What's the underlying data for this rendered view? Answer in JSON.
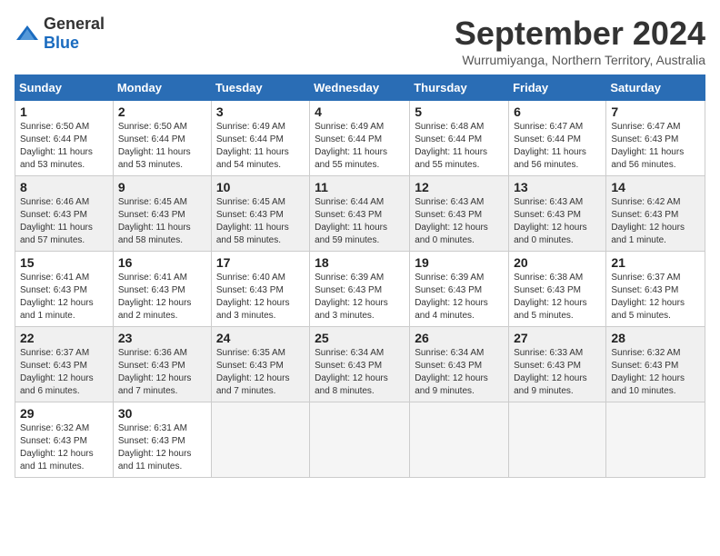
{
  "logo": {
    "general": "General",
    "blue": "Blue"
  },
  "title": "September 2024",
  "subtitle": "Wurrumiyanga, Northern Territory, Australia",
  "headers": [
    "Sunday",
    "Monday",
    "Tuesday",
    "Wednesday",
    "Thursday",
    "Friday",
    "Saturday"
  ],
  "weeks": [
    [
      {
        "day": "1",
        "sunrise": "Sunrise: 6:50 AM",
        "sunset": "Sunset: 6:44 PM",
        "daylight": "Daylight: 11 hours and 53 minutes."
      },
      {
        "day": "2",
        "sunrise": "Sunrise: 6:50 AM",
        "sunset": "Sunset: 6:44 PM",
        "daylight": "Daylight: 11 hours and 53 minutes."
      },
      {
        "day": "3",
        "sunrise": "Sunrise: 6:49 AM",
        "sunset": "Sunset: 6:44 PM",
        "daylight": "Daylight: 11 hours and 54 minutes."
      },
      {
        "day": "4",
        "sunrise": "Sunrise: 6:49 AM",
        "sunset": "Sunset: 6:44 PM",
        "daylight": "Daylight: 11 hours and 55 minutes."
      },
      {
        "day": "5",
        "sunrise": "Sunrise: 6:48 AM",
        "sunset": "Sunset: 6:44 PM",
        "daylight": "Daylight: 11 hours and 55 minutes."
      },
      {
        "day": "6",
        "sunrise": "Sunrise: 6:47 AM",
        "sunset": "Sunset: 6:44 PM",
        "daylight": "Daylight: 11 hours and 56 minutes."
      },
      {
        "day": "7",
        "sunrise": "Sunrise: 6:47 AM",
        "sunset": "Sunset: 6:43 PM",
        "daylight": "Daylight: 11 hours and 56 minutes."
      }
    ],
    [
      {
        "day": "8",
        "sunrise": "Sunrise: 6:46 AM",
        "sunset": "Sunset: 6:43 PM",
        "daylight": "Daylight: 11 hours and 57 minutes."
      },
      {
        "day": "9",
        "sunrise": "Sunrise: 6:45 AM",
        "sunset": "Sunset: 6:43 PM",
        "daylight": "Daylight: 11 hours and 58 minutes."
      },
      {
        "day": "10",
        "sunrise": "Sunrise: 6:45 AM",
        "sunset": "Sunset: 6:43 PM",
        "daylight": "Daylight: 11 hours and 58 minutes."
      },
      {
        "day": "11",
        "sunrise": "Sunrise: 6:44 AM",
        "sunset": "Sunset: 6:43 PM",
        "daylight": "Daylight: 11 hours and 59 minutes."
      },
      {
        "day": "12",
        "sunrise": "Sunrise: 6:43 AM",
        "sunset": "Sunset: 6:43 PM",
        "daylight": "Daylight: 12 hours and 0 minutes."
      },
      {
        "day": "13",
        "sunrise": "Sunrise: 6:43 AM",
        "sunset": "Sunset: 6:43 PM",
        "daylight": "Daylight: 12 hours and 0 minutes."
      },
      {
        "day": "14",
        "sunrise": "Sunrise: 6:42 AM",
        "sunset": "Sunset: 6:43 PM",
        "daylight": "Daylight: 12 hours and 1 minute."
      }
    ],
    [
      {
        "day": "15",
        "sunrise": "Sunrise: 6:41 AM",
        "sunset": "Sunset: 6:43 PM",
        "daylight": "Daylight: 12 hours and 1 minute."
      },
      {
        "day": "16",
        "sunrise": "Sunrise: 6:41 AM",
        "sunset": "Sunset: 6:43 PM",
        "daylight": "Daylight: 12 hours and 2 minutes."
      },
      {
        "day": "17",
        "sunrise": "Sunrise: 6:40 AM",
        "sunset": "Sunset: 6:43 PM",
        "daylight": "Daylight: 12 hours and 3 minutes."
      },
      {
        "day": "18",
        "sunrise": "Sunrise: 6:39 AM",
        "sunset": "Sunset: 6:43 PM",
        "daylight": "Daylight: 12 hours and 3 minutes."
      },
      {
        "day": "19",
        "sunrise": "Sunrise: 6:39 AM",
        "sunset": "Sunset: 6:43 PM",
        "daylight": "Daylight: 12 hours and 4 minutes."
      },
      {
        "day": "20",
        "sunrise": "Sunrise: 6:38 AM",
        "sunset": "Sunset: 6:43 PM",
        "daylight": "Daylight: 12 hours and 5 minutes."
      },
      {
        "day": "21",
        "sunrise": "Sunrise: 6:37 AM",
        "sunset": "Sunset: 6:43 PM",
        "daylight": "Daylight: 12 hours and 5 minutes."
      }
    ],
    [
      {
        "day": "22",
        "sunrise": "Sunrise: 6:37 AM",
        "sunset": "Sunset: 6:43 PM",
        "daylight": "Daylight: 12 hours and 6 minutes."
      },
      {
        "day": "23",
        "sunrise": "Sunrise: 6:36 AM",
        "sunset": "Sunset: 6:43 PM",
        "daylight": "Daylight: 12 hours and 7 minutes."
      },
      {
        "day": "24",
        "sunrise": "Sunrise: 6:35 AM",
        "sunset": "Sunset: 6:43 PM",
        "daylight": "Daylight: 12 hours and 7 minutes."
      },
      {
        "day": "25",
        "sunrise": "Sunrise: 6:34 AM",
        "sunset": "Sunset: 6:43 PM",
        "daylight": "Daylight: 12 hours and 8 minutes."
      },
      {
        "day": "26",
        "sunrise": "Sunrise: 6:34 AM",
        "sunset": "Sunset: 6:43 PM",
        "daylight": "Daylight: 12 hours and 9 minutes."
      },
      {
        "day": "27",
        "sunrise": "Sunrise: 6:33 AM",
        "sunset": "Sunset: 6:43 PM",
        "daylight": "Daylight: 12 hours and 9 minutes."
      },
      {
        "day": "28",
        "sunrise": "Sunrise: 6:32 AM",
        "sunset": "Sunset: 6:43 PM",
        "daylight": "Daylight: 12 hours and 10 minutes."
      }
    ],
    [
      {
        "day": "29",
        "sunrise": "Sunrise: 6:32 AM",
        "sunset": "Sunset: 6:43 PM",
        "daylight": "Daylight: 12 hours and 11 minutes."
      },
      {
        "day": "30",
        "sunrise": "Sunrise: 6:31 AM",
        "sunset": "Sunset: 6:43 PM",
        "daylight": "Daylight: 12 hours and 11 minutes."
      },
      null,
      null,
      null,
      null,
      null
    ]
  ]
}
